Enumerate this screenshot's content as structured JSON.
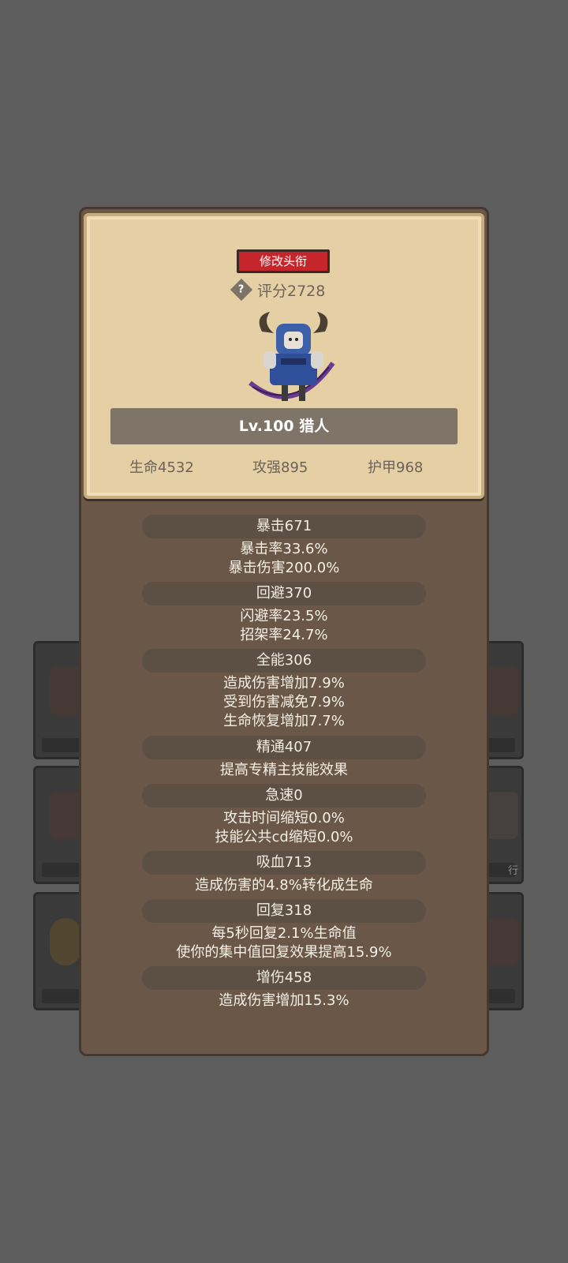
{
  "character": {
    "title_button": "修改头衔",
    "score_label": "评分2728",
    "level_name": "Lv.100 猎人",
    "primary_stats": [
      "生命4532",
      "攻强895",
      "护甲968"
    ]
  },
  "stats": [
    {
      "header": "暴击671",
      "lines": [
        "暴击率33.6%",
        "暴击伤害200.0%"
      ]
    },
    {
      "header": "回避370",
      "lines": [
        "闪避率23.5%",
        "招架率24.7%"
      ]
    },
    {
      "header": "全能306",
      "lines": [
        "造成伤害增加7.9%",
        "受到伤害减免7.9%",
        "生命恢复增加7.7%"
      ]
    },
    {
      "header": "精通407",
      "lines": [
        "提高专精主技能效果"
      ]
    },
    {
      "header": "急速0",
      "lines": [
        "攻击时间缩短0.0%",
        "技能公共cd缩短0.0%"
      ]
    },
    {
      "header": "吸血713",
      "lines": [
        "造成伤害的4.8%转化成生命"
      ]
    },
    {
      "header": "回复318",
      "lines": [
        "每5秒回复2.1%生命值",
        "使你的集中值回复效果提高15.9%"
      ]
    },
    {
      "header": "增伤458",
      "lines": [
        "造成伤害增加15.3%"
      ]
    }
  ],
  "background_tag": "行",
  "icons": {
    "help": "question-diamond-icon"
  }
}
